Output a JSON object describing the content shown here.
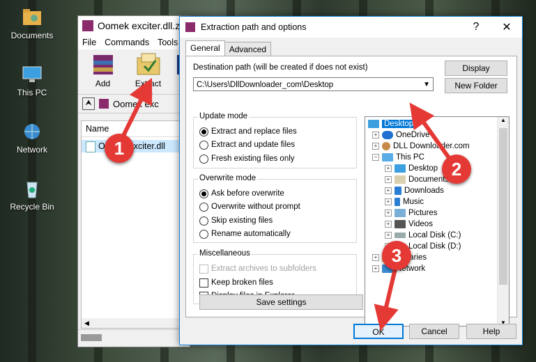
{
  "desktop": {
    "icons": [
      {
        "label": "Documents"
      },
      {
        "label": "This PC"
      },
      {
        "label": "Network"
      },
      {
        "label": "Recycle Bin"
      }
    ]
  },
  "winrar": {
    "title": "Oomek exciter.dll.zip",
    "menu": [
      "File",
      "Commands",
      "Tools"
    ],
    "toolbar": [
      {
        "label": "Add"
      },
      {
        "label": "Extract To"
      },
      {
        "label": "T"
      }
    ],
    "path": "Oomek exc",
    "list_header": "Name",
    "file_row": "Oomek exciter.dll"
  },
  "dialog": {
    "title": "Extraction path and options",
    "help_glyph": "?",
    "close_glyph": "✕",
    "tabs": [
      "General",
      "Advanced"
    ],
    "dest_label": "Destination path (will be created if does not exist)",
    "dest_value": "C:\\Users\\DllDownloader_com\\Desktop",
    "display_btn": "Display",
    "new_folder_btn": "New Folder",
    "update_mode": {
      "title": "Update mode",
      "options": [
        "Extract and replace files",
        "Extract and update files",
        "Fresh existing files only"
      ],
      "selected": 0
    },
    "overwrite_mode": {
      "title": "Overwrite mode",
      "options": [
        "Ask before overwrite",
        "Overwrite without prompt",
        "Skip existing files",
        "Rename automatically"
      ],
      "selected": 0
    },
    "misc": {
      "title": "Miscellaneous",
      "options": [
        "Extract archives to subfolders",
        "Keep broken files",
        "Display files in Explorer"
      ]
    },
    "save_settings": "Save settings",
    "tree": {
      "items": [
        "Desktop",
        "OneDrive",
        "DLL Downloader.com",
        "This PC",
        "Desktop",
        "Documents",
        "Downloads",
        "Music",
        "Pictures",
        "Videos",
        "Local Disk (C:)",
        "Local Disk (D:)",
        "Libraries",
        "Network"
      ]
    },
    "ok": "OK",
    "cancel": "Cancel",
    "help": "Help"
  },
  "annotations": [
    "1",
    "2",
    "3"
  ],
  "colors": {
    "accent": "#0078d7",
    "badge": "#e53935"
  }
}
